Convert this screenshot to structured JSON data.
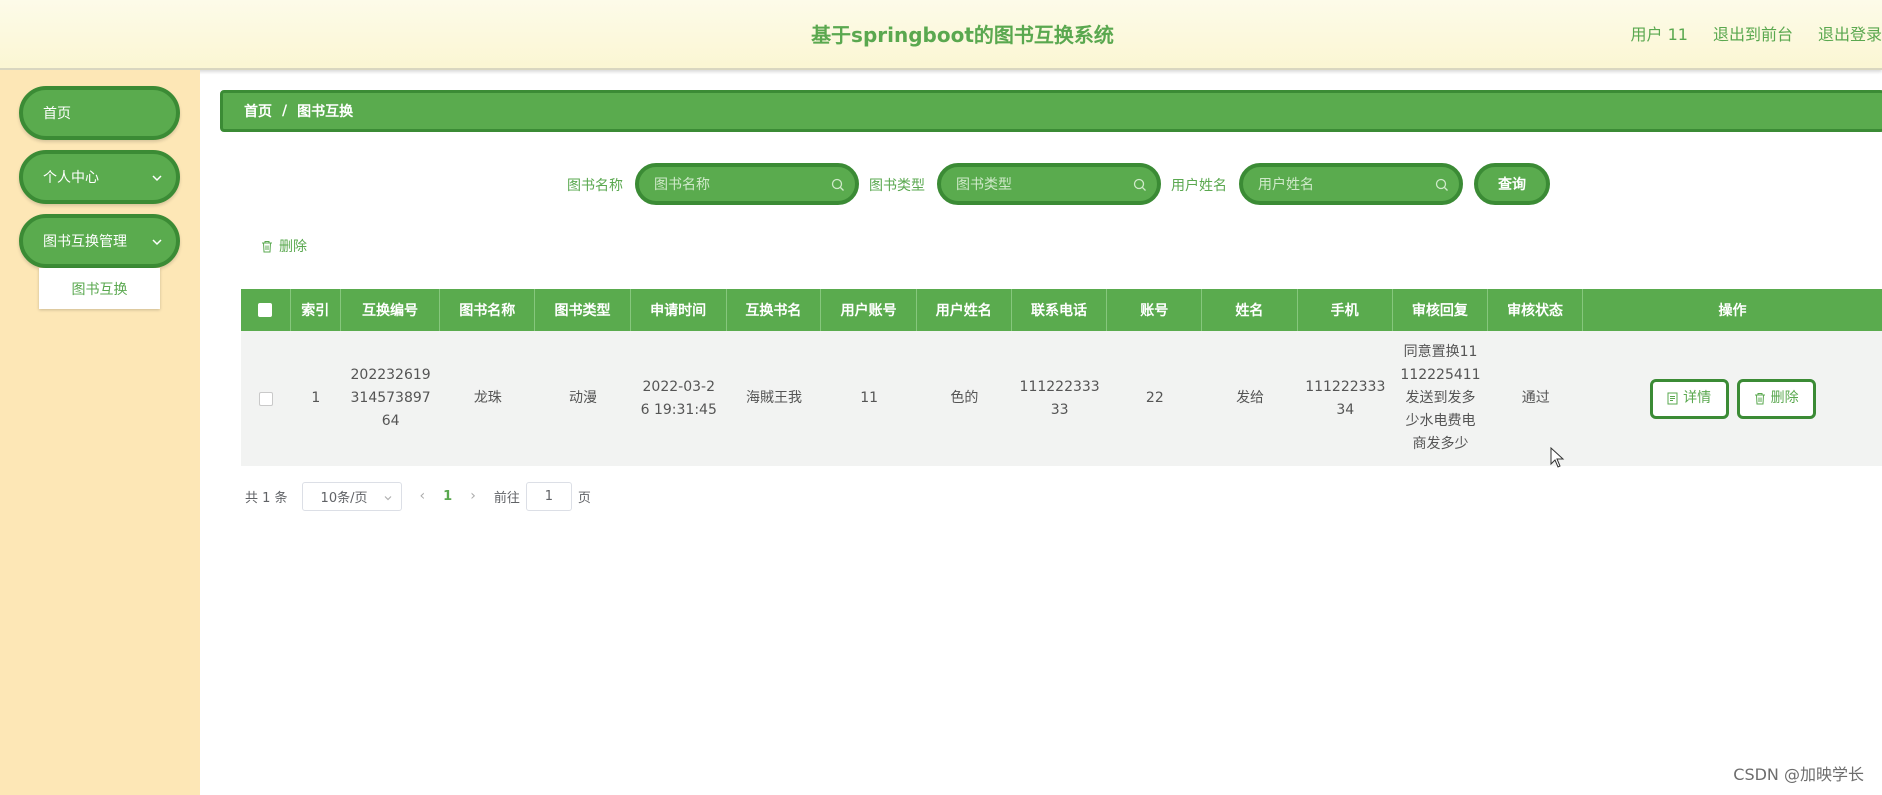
{
  "header": {
    "title": "基于springboot的图书互换系统",
    "user": "用户 11",
    "back_front": "退出到前台",
    "logout": "退出登录"
  },
  "sidebar": {
    "items": [
      {
        "label": "首页"
      },
      {
        "label": "个人中心"
      },
      {
        "label": "图书互换管理"
      }
    ],
    "submenu": "图书互换"
  },
  "breadcrumb": {
    "home": "首页",
    "sep": "/",
    "current": "图书互换"
  },
  "search": {
    "book_name_label": "图书名称",
    "book_name_placeholder": "图书名称",
    "book_type_label": "图书类型",
    "book_type_placeholder": "图书类型",
    "user_name_label": "用户姓名",
    "user_name_placeholder": "用户姓名",
    "query": "查询"
  },
  "toolbar": {
    "delete": "删除"
  },
  "table": {
    "headers": [
      "索引",
      "互换编号",
      "图书名称",
      "图书类型",
      "申请时间",
      "互换书名",
      "用户账号",
      "用户姓名",
      "联系电话",
      "账号",
      "姓名",
      "手机",
      "审核回复",
      "审核状态",
      "操作"
    ],
    "rows": [
      {
        "index": "1",
        "exchange_no": "202232619314573897 64",
        "exchange_no_l1": "202232619",
        "exchange_no_l2": "314573897",
        "exchange_no_l3": "64",
        "book_name": "龙珠",
        "book_type": "动漫",
        "apply_time_l1": "2022-03-2",
        "apply_time_l2": "6 19:31:45",
        "exchange_book": "海賊王我",
        "user_account": "11",
        "user_name": "色的",
        "phone_l1": "111222333",
        "phone_l2": "33",
        "account": "22",
        "name": "发给",
        "mobile_l1": "111222333",
        "mobile_l2": "34",
        "reply_l1": "同意置换11",
        "reply_l2": "112225411",
        "reply_l3": "发送到发多",
        "reply_l4": "少水电费电",
        "reply_l5": "商发多少",
        "status": "通过",
        "detail_btn": "详情",
        "delete_btn": "删除"
      }
    ]
  },
  "pager": {
    "total": "共 1 条",
    "page_size": "10条/页",
    "current": "1",
    "goto_label": "前往",
    "goto_value": "1",
    "page_suffix": "页"
  },
  "watermark": "CSDN @加映学长",
  "colors": {
    "primary": "#5aab4e",
    "primary_dark": "#3b8b35",
    "sidebar_bg": "#fde7b6"
  }
}
